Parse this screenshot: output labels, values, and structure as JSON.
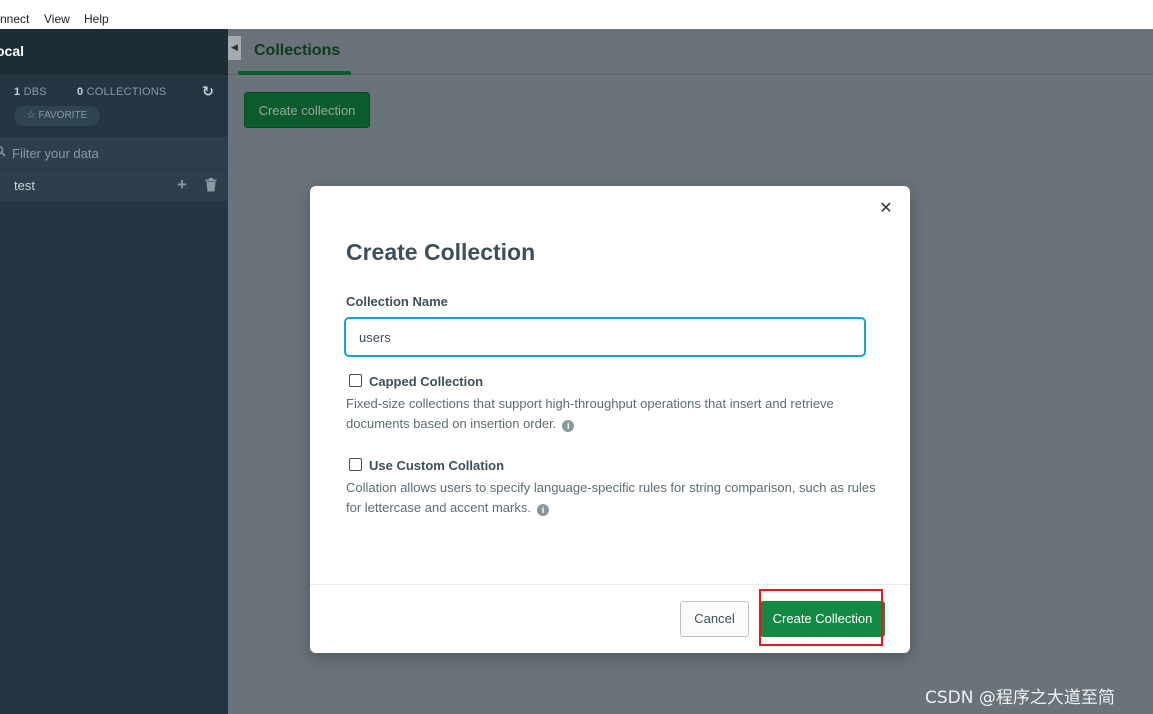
{
  "menubar": {
    "items": [
      "nnect",
      "View",
      "Help"
    ]
  },
  "sidebar": {
    "title": "ocal",
    "dbs_count": "1",
    "dbs_label": "DBS",
    "collections_count": "0",
    "collections_label": "COLLECTIONS",
    "favorite_label": "☆ FAVORITE",
    "filter_placeholder": "Filter your data",
    "databases": [
      {
        "name": "test"
      }
    ]
  },
  "main": {
    "tab_label": "Collections",
    "create_button": "Create collection"
  },
  "modal": {
    "title": "Create Collection",
    "name_label": "Collection Name",
    "name_value": "users",
    "capped": {
      "label": "Capped Collection",
      "description": "Fixed-size collections that support high-throughput operations that insert and retrieve documents based on insertion order."
    },
    "collation": {
      "label": "Use Custom Collation",
      "description": "Collation allows users to specify language-specific rules for string comparison, such as rules for lettercase and accent marks."
    },
    "cancel_label": "Cancel",
    "create_label": "Create Collection"
  },
  "watermark": "CSDN @程序之大道至简",
  "colors": {
    "sidebar_bg": "#243642",
    "accent_green": "#138a44",
    "input_focus": "#1a9fe0",
    "highlight_red": "#e01b1b"
  }
}
